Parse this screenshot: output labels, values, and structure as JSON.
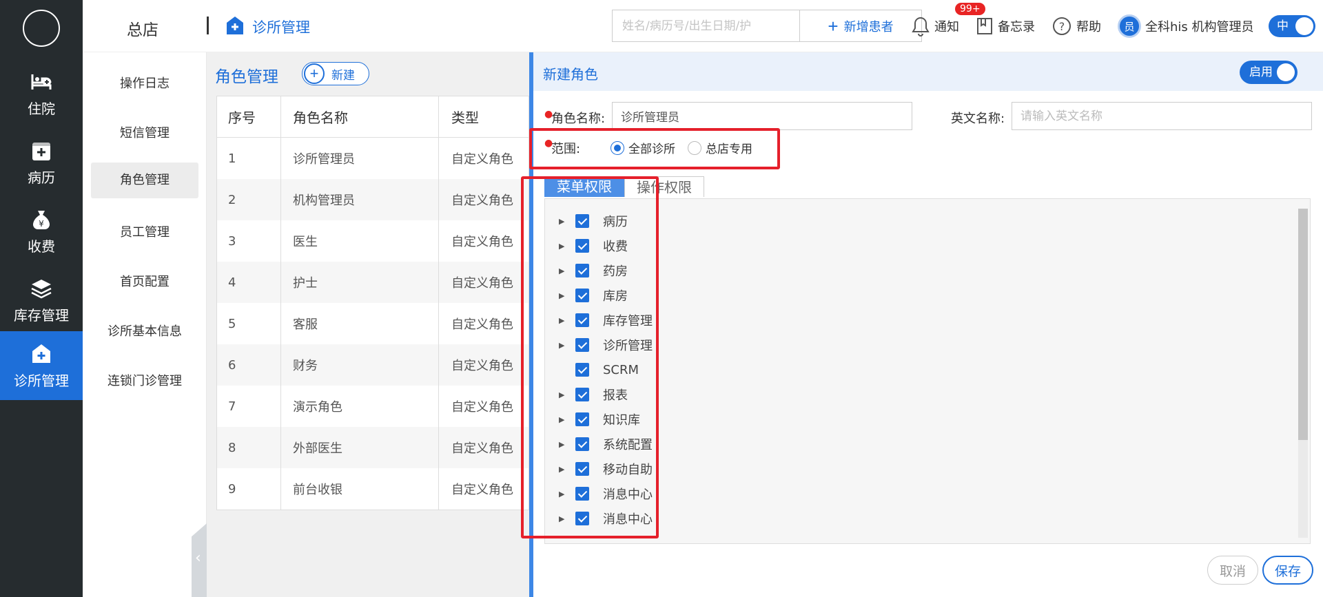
{
  "app": {
    "brand": "总店",
    "module_title": "诊所管理"
  },
  "leftnav": {
    "items": [
      {
        "label": "住院",
        "icon": "hospital-bed-icon"
      },
      {
        "label": "病历",
        "icon": "medical-record-icon"
      },
      {
        "label": "收费",
        "icon": "money-bag-icon"
      },
      {
        "label": "库存管理",
        "icon": "layers-icon"
      },
      {
        "label": "诊所管理",
        "icon": "clinic-icon",
        "active": true
      }
    ]
  },
  "header": {
    "search_placeholder": "姓名/病历号/出生日期/护",
    "add_patient": "新增患者",
    "notify": "通知",
    "notify_badge": "99+",
    "memo": "备忘录",
    "help": "帮助",
    "avatar_char": "员",
    "user": "全科his 机构管理员",
    "lang": "中"
  },
  "subnav": {
    "items": [
      "操作日志",
      "短信管理",
      "角色管理",
      "员工管理",
      "首页配置",
      "诊所基本信息",
      "连锁门诊管理"
    ],
    "active_index": 2
  },
  "rolepanel": {
    "title": "角色管理",
    "new_label": "新建",
    "columns": [
      "序号",
      "角色名称",
      "类型"
    ],
    "rows": [
      [
        "1",
        "诊所管理员",
        "自定义角色"
      ],
      [
        "2",
        "机构管理员",
        "自定义角色"
      ],
      [
        "3",
        "医生",
        "自定义角色"
      ],
      [
        "4",
        "护士",
        "自定义角色"
      ],
      [
        "5",
        "客服",
        "自定义角色"
      ],
      [
        "6",
        "财务",
        "自定义角色"
      ],
      [
        "7",
        "演示角色",
        "自定义角色"
      ],
      [
        "8",
        "外部医生",
        "自定义角色"
      ],
      [
        "9",
        "前台收银",
        "自定义角色"
      ]
    ]
  },
  "form": {
    "title": "新建角色",
    "enable": "启用",
    "role_name_label": "角色名称:",
    "role_name_value": "诊所管理员",
    "en_name_label": "英文名称:",
    "en_name_placeholder": "请输入英文名称",
    "scope_label": "范围:",
    "scope_options": [
      "全部诊所",
      "总店专用"
    ],
    "scope_selected": "全部诊所",
    "tabs": [
      "菜单权限",
      "操作权限"
    ],
    "tree": [
      {
        "label": "病历",
        "expandable": true
      },
      {
        "label": "收费",
        "expandable": true
      },
      {
        "label": "药房",
        "expandable": true
      },
      {
        "label": "库房",
        "expandable": true
      },
      {
        "label": "库存管理",
        "expandable": true
      },
      {
        "label": "诊所管理",
        "expandable": true
      },
      {
        "label": "SCRM",
        "expandable": false
      },
      {
        "label": "报表",
        "expandable": true
      },
      {
        "label": "知识库",
        "expandable": true
      },
      {
        "label": "系统配置",
        "expandable": true
      },
      {
        "label": "移动自助",
        "expandable": true
      },
      {
        "label": "消息中心",
        "expandable": true
      },
      {
        "label": "消息中心",
        "expandable": true
      }
    ],
    "cancel": "取消",
    "save": "保存"
  },
  "colors": {
    "primary": "#1e6fd9",
    "nav_bg": "#262c2f",
    "highlight": "#e5202b"
  }
}
